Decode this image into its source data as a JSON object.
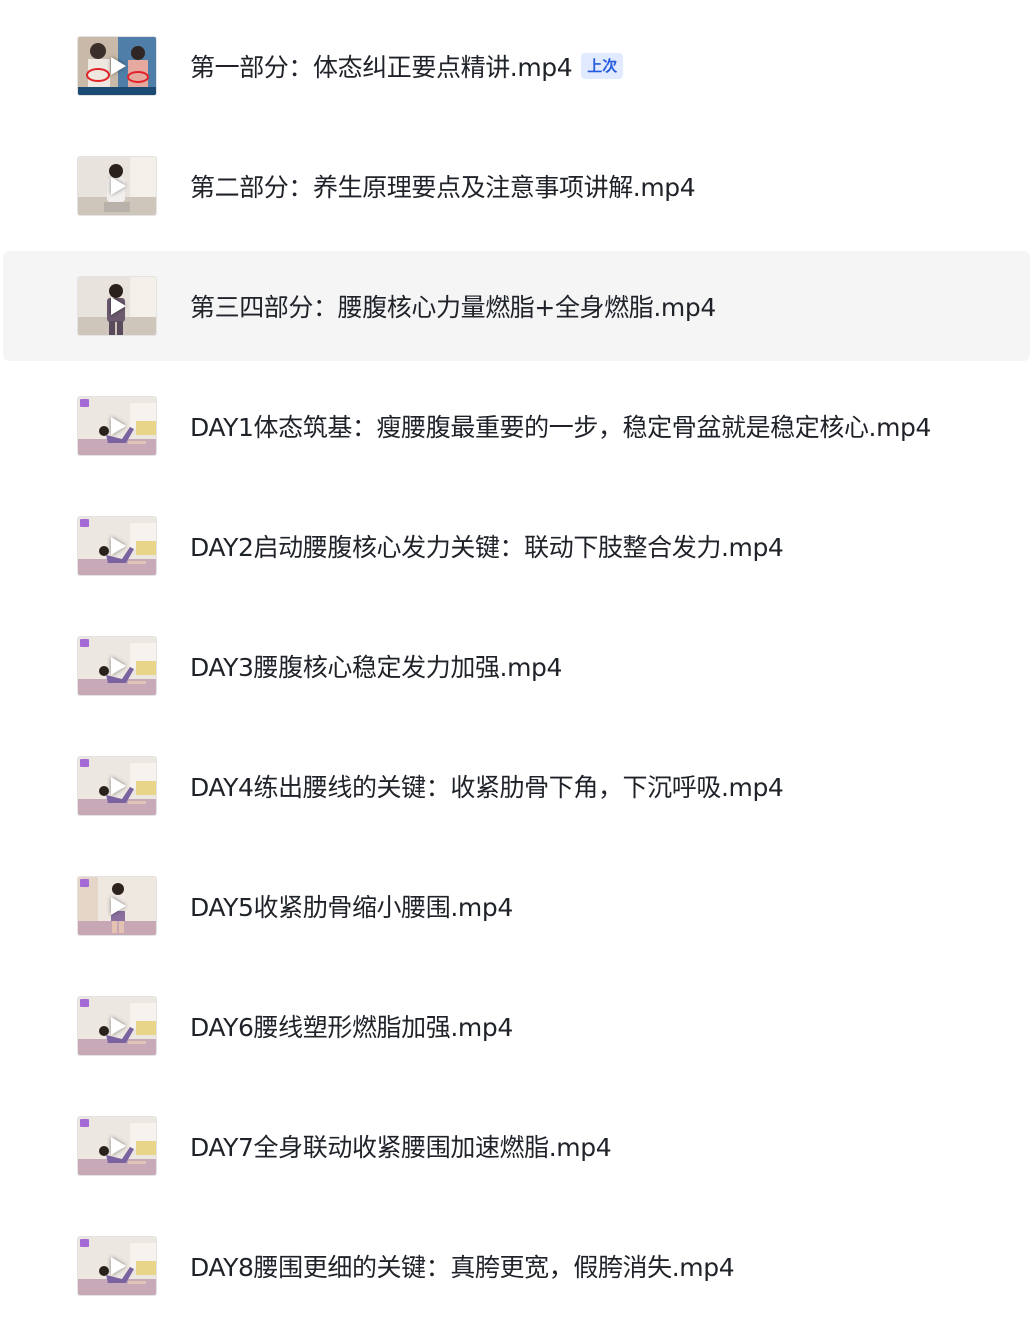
{
  "files": [
    {
      "title": "第一部分：体态纠正要点精讲.mp4",
      "badge": "上次",
      "thumb": "cover-a"
    },
    {
      "title": "第二部分：养生原理要点及注意事项讲解.mp4",
      "badge": null,
      "thumb": "talk"
    },
    {
      "title": "第三四部分：腰腹核心力量燃脂+全身燃脂.mp4",
      "badge": null,
      "thumb": "talk-standing",
      "highlighted": true
    },
    {
      "title": "DAY1体态筑基：瘦腰腹最重要的一步，稳定骨盆就是稳定核心.mp4",
      "badge": null,
      "thumb": "floor"
    },
    {
      "title": "DAY2启动腰腹核心发力关键：联动下肢整合发力.mp4",
      "badge": null,
      "thumb": "floor"
    },
    {
      "title": "DAY3腰腹核心稳定发力加强.mp4",
      "badge": null,
      "thumb": "floor"
    },
    {
      "title": "DAY4练出腰线的关键：收紧肋骨下角，下沉呼吸.mp4",
      "badge": null,
      "thumb": "floor"
    },
    {
      "title": "DAY5收紧肋骨缩小腰围.mp4",
      "badge": null,
      "thumb": "standing"
    },
    {
      "title": "DAY6腰线塑形燃脂加强.mp4",
      "badge": null,
      "thumb": "floor"
    },
    {
      "title": "DAY7全身联动收紧腰围加速燃脂.mp4",
      "badge": null,
      "thumb": "floor"
    },
    {
      "title": "DAY8腰围更细的关键：真胯更宽，假胯消失.mp4",
      "badge": null,
      "thumb": "floor"
    }
  ],
  "colors": {
    "text": "#1f2329",
    "badge_bg": "#e1eaff",
    "badge_text": "#245bdb",
    "row_highlight": "#f5f5f6"
  },
  "icons": [
    "play-icon",
    "video-thumbnail"
  ]
}
